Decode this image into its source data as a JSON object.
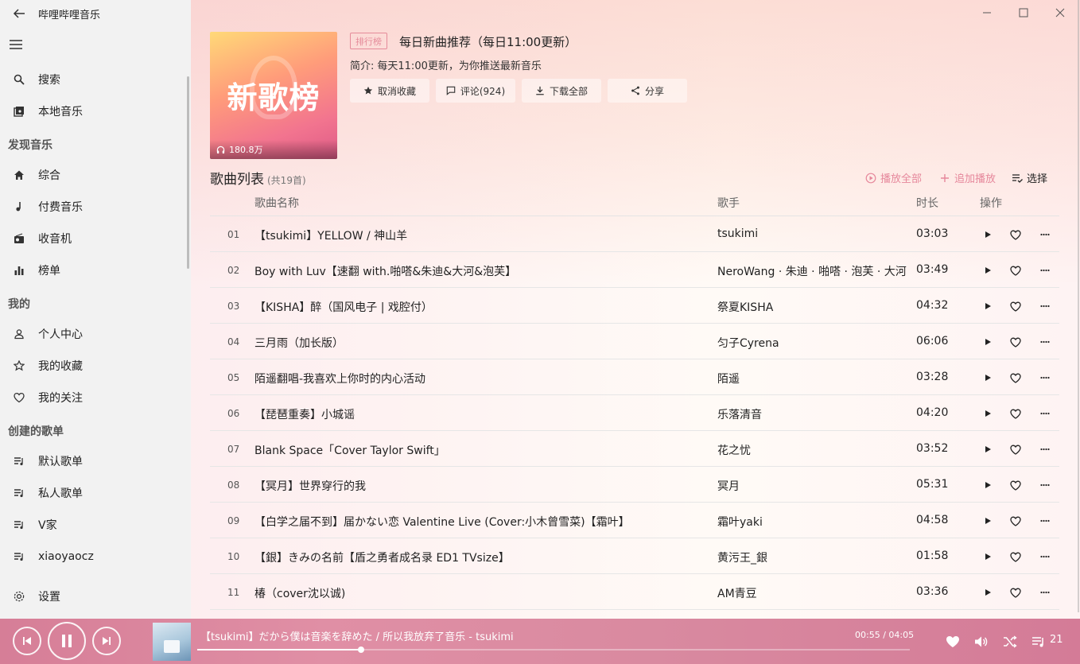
{
  "app": {
    "title": "哔哩哔哩音乐"
  },
  "sidebar": {
    "search": "搜索",
    "local": "本地音乐",
    "sections": {
      "discover": "发现音乐",
      "mine": "我的",
      "created": "创建的歌单"
    },
    "discover_items": [
      "综合",
      "付费音乐",
      "收音机",
      "榜单"
    ],
    "mine_items": [
      "个人中心",
      "我的收藏",
      "我的关注"
    ],
    "playlists": [
      "默认歌单",
      "私人歌单",
      "V家",
      "xiaoyaocz"
    ],
    "settings": "设置"
  },
  "playlist": {
    "cover_text": "新歌榜",
    "play_count": "180.8万",
    "badge": "排行榜",
    "title": "每日新曲推荐（每日11:00更新）",
    "desc_label": "简介:",
    "desc": "每天11:00更新，为你推送最新音乐",
    "actions": {
      "unfav": "取消收藏",
      "comment": "评论(924)",
      "download": "下载全部",
      "share": "分享"
    }
  },
  "songs": {
    "heading": "歌曲列表",
    "count": "(共19首)",
    "play_all": "播放全部",
    "add_play": "追加播放",
    "select": "选择",
    "columns": {
      "name": "歌曲名称",
      "artist": "歌手",
      "duration": "时长",
      "ops": "操作"
    },
    "rows": [
      {
        "idx": "01",
        "title": "【tsukimi】YELLOW / 神山羊",
        "artist": "tsukimi",
        "dur": "03:03"
      },
      {
        "idx": "02",
        "title": "Boy with Luv【速翻 with.啪嗒&朱迪&大河&泡芙】",
        "artist": "NeroWang · 朱迪 · 啪嗒 · 泡芙 · 大河",
        "dur": "03:49"
      },
      {
        "idx": "03",
        "title": "【KISHA】醉（国风电子 | 戏腔付）",
        "artist": "祭夏KISHA",
        "dur": "04:32"
      },
      {
        "idx": "04",
        "title": "三月雨（加长版）",
        "artist": "匀子Cyrena",
        "dur": "06:06"
      },
      {
        "idx": "05",
        "title": "陌遥翻唱-我喜欢上你时的内心活动",
        "artist": "陌遥",
        "dur": "03:28"
      },
      {
        "idx": "06",
        "title": "【琵琶重奏】小城谣",
        "artist": "乐落清音",
        "dur": "04:20"
      },
      {
        "idx": "07",
        "title": "Blank Space「Cover Taylor Swift」",
        "artist": "花之忧",
        "dur": "03:52"
      },
      {
        "idx": "08",
        "title": "【冥月】世界穿行的我",
        "artist": "冥月",
        "dur": "05:31"
      },
      {
        "idx": "09",
        "title": "【白学之届不到】届かない恋 Valentine Live (Cover:小木曾雪菜)【霜叶】",
        "artist": "霜叶yaki",
        "dur": "04:58"
      },
      {
        "idx": "10",
        "title": "【銀】きみの名前【盾之勇者成名录 ED1 TVsize】",
        "artist": "黄污王_銀",
        "dur": "01:58"
      },
      {
        "idx": "11",
        "title": "椿（cover沈以诚)",
        "artist": "AM青豆",
        "dur": "03:36"
      }
    ]
  },
  "player": {
    "now_playing": "【tsukimi】だから僕は音楽を辞めた / 所以我放弃了音乐 - tsukimi",
    "time": "00:55 / 04:05",
    "progress": 0.23,
    "queue_count": "21"
  },
  "colors": {
    "accent": "#e6879b",
    "player_bg": "#d98aa0",
    "sidebar_bg": "#f2f2f2"
  }
}
